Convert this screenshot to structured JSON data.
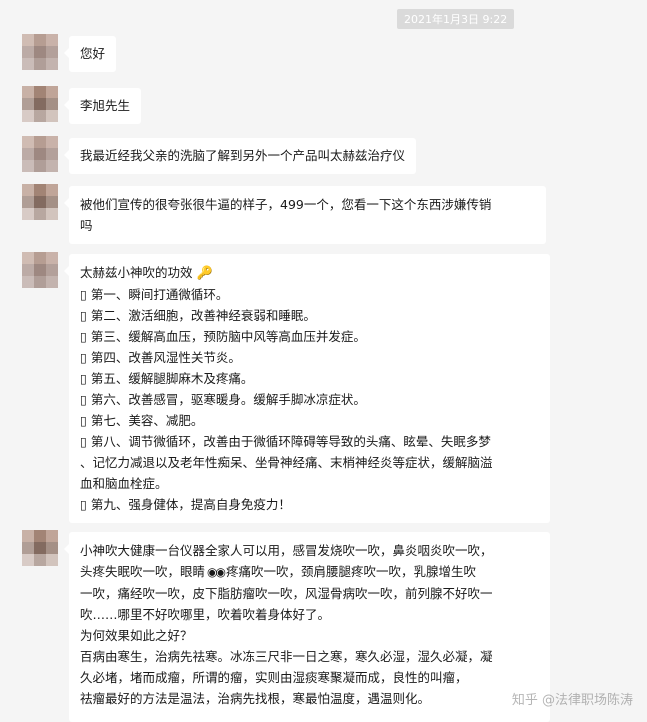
{
  "timestamp": "2021年1月3日 9:22",
  "messages": [
    {
      "text": "您好"
    },
    {
      "text": "李旭先生"
    },
    {
      "text": "我最近经我父亲的洗脑了解到另外一个产品叫太赫兹治疗仪"
    },
    {
      "lines": [
        "被他们宣传的很夸张很牛逼的样子，499一个，您看一下这个东西涉嫌传销",
        "吗"
      ]
    },
    {
      "title": "太赫兹小神吹的功效",
      "title_icon": "key-icon",
      "lines": [
        "▯ 第一、瞬间打通微循环。",
        "▯ 第二、激活细胞，改善神经衰弱和睡眠。",
        "▯ 第三、缓解高血压，预防脑中风等高血压并发症。",
        "▯ 第四、改善风湿性关节炎。",
        "▯ 第五、缓解腿脚麻木及疼痛。",
        "▯ 第六、改善感冒，驱寒暖身。缓解手脚冰凉症状。",
        "▯ 第七、美容、减肥。",
        "▯ 第八、调节微循环，改善由于微循环障碍等导致的头痛、眩晕、失眠多梦",
        "、记忆力减退以及老年性痴呆、坐骨神经痛、末梢神经炎等症状，缓解脑溢",
        "血和脑血栓症。",
        "▯ 第九、强身健体，提高自身免疫力！"
      ]
    },
    {
      "line1": "小神吹大健康一台仪器全家人可以用，感冒发烧吹一吹，鼻炎咽炎吹一吹，",
      "line2_a": "头疼失眠吹一吹，眼睛",
      "line2_icon": "eyes-icon",
      "line2_b": "疼痛吹一吹，颈肩腰腿疼吹一吹，乳腺增生吹",
      "lines": [
        "一吹，痛经吹一吹，皮下脂肪瘤吹一吹，风湿骨病吹一吹，前列腺不好吹一",
        "吹……哪里不好吹哪里，吹着吹着身体好了。",
        "为何效果如此之好？",
        "百病由寒生，治病先祛寒。冰冻三尺非一日之寒，寒久必湿，湿久必凝，凝",
        "久必堵，堵而成瘤，所谓的瘤，实则由湿痰寒聚凝而成，良性的叫瘤，",
        "祛瘤最好的方法是温法，治病先找根，寒最怕温度，遇温则化。"
      ]
    }
  ],
  "watermark": "知乎 @法律职场陈涛"
}
